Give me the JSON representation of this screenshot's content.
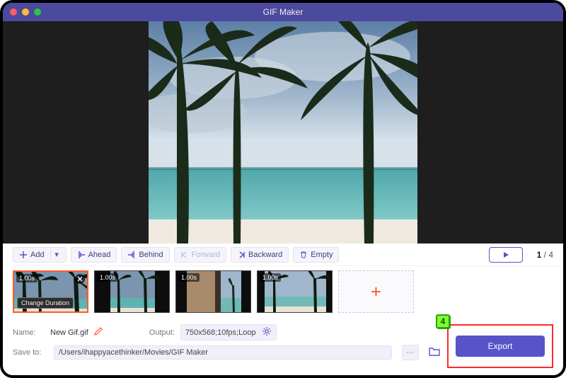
{
  "window": {
    "title": "GIF Maker"
  },
  "toolbar": {
    "add": "Add",
    "ahead": "Ahead",
    "behind": "Behind",
    "forward": "Forward",
    "backward": "Backward",
    "empty": "Empty"
  },
  "playback": {
    "current": "1",
    "sep": " / ",
    "total": "4"
  },
  "frames": [
    {
      "duration": "1.00s",
      "selected": true,
      "change_label": "Change Duration"
    },
    {
      "duration": "1.00s"
    },
    {
      "duration": "1.00s"
    },
    {
      "duration": "1.00s"
    }
  ],
  "fields": {
    "name_label": "Name:",
    "name_value": "New Gif.gif",
    "output_label": "Output:",
    "output_value": "750x568;10fps;Loop",
    "save_label": "Save to:",
    "save_value": "/Users/ihappyacethinker/Movies/GIF Maker"
  },
  "export": {
    "label": "Export",
    "step": "4"
  }
}
